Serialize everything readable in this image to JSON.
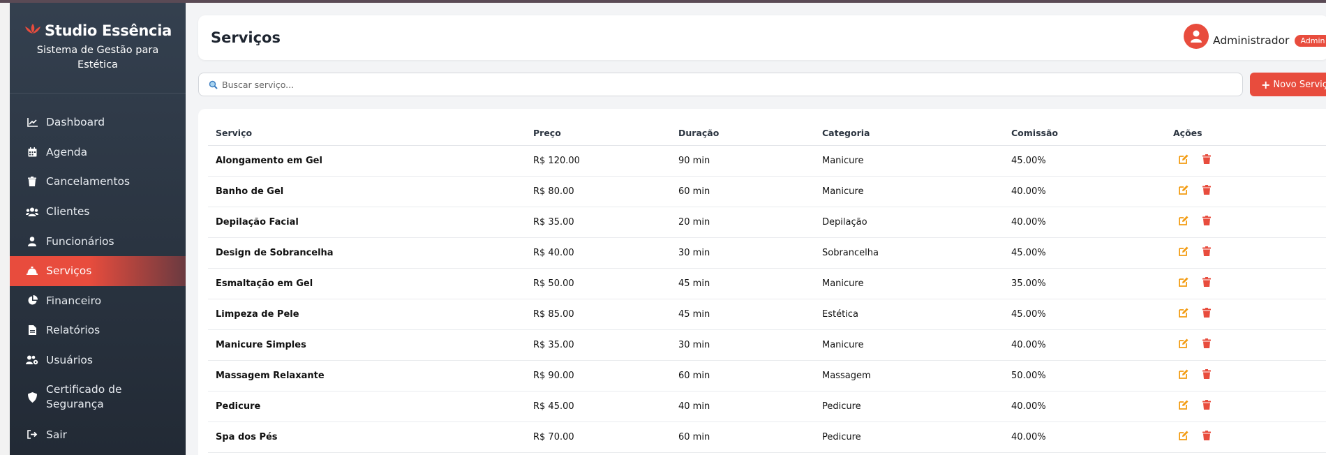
{
  "brand": {
    "title": "Studio Essência",
    "subtitle": "Sistema de Gestão para Estética",
    "accent": "#e84c3d"
  },
  "sidebar": {
    "items": [
      {
        "label": "Dashboard",
        "icon": "chart-line-icon"
      },
      {
        "label": "Agenda",
        "icon": "calendar-icon"
      },
      {
        "label": "Cancelamentos",
        "icon": "trash-icon"
      },
      {
        "label": "Clientes",
        "icon": "users-icon"
      },
      {
        "label": "Funcionários",
        "icon": "user-icon"
      },
      {
        "label": "Serviços",
        "icon": "concierge-bell-icon",
        "active": true
      },
      {
        "label": "Financeiro",
        "icon": "pie-chart-icon"
      },
      {
        "label": "Relatórios",
        "icon": "file-icon"
      },
      {
        "label": "Usuários",
        "icon": "users-cog-icon"
      },
      {
        "label": "Certificado de Segurança",
        "icon": "shield-icon"
      },
      {
        "label": "Sair",
        "icon": "sign-out-icon"
      }
    ]
  },
  "header": {
    "title": "Serviços",
    "user_name": "Administrador",
    "role_badge": "Admin"
  },
  "search": {
    "placeholder": "Buscar serviço..."
  },
  "toolbar": {
    "new_label": "Novo Serviço"
  },
  "table": {
    "columns": [
      "Serviço",
      "Preço",
      "Duração",
      "Categoria",
      "Comissão",
      "Ações"
    ],
    "rows": [
      [
        "Alongamento em Gel",
        "R$ 120.00",
        "90 min",
        "Manicure",
        "45.00%"
      ],
      [
        "Banho de Gel",
        "R$ 80.00",
        "60 min",
        "Manicure",
        "40.00%"
      ],
      [
        "Depilação Facial",
        "R$ 35.00",
        "20 min",
        "Depilação",
        "40.00%"
      ],
      [
        "Design de Sobrancelha",
        "R$ 40.00",
        "30 min",
        "Sobrancelha",
        "45.00%"
      ],
      [
        "Esmaltação em Gel",
        "R$ 50.00",
        "45 min",
        "Manicure",
        "35.00%"
      ],
      [
        "Limpeza de Pele",
        "R$ 85.00",
        "45 min",
        "Estética",
        "45.00%"
      ],
      [
        "Manicure Simples",
        "R$ 35.00",
        "30 min",
        "Manicure",
        "40.00%"
      ],
      [
        "Massagem Relaxante",
        "R$ 90.00",
        "60 min",
        "Massagem",
        "50.00%"
      ],
      [
        "Pedicure",
        "R$ 45.00",
        "40 min",
        "Pedicure",
        "40.00%"
      ],
      [
        "Spa dos Pés",
        "R$ 70.00",
        "60 min",
        "Pedicure",
        "40.00%"
      ]
    ]
  },
  "colors": {
    "edit_icon": "#f39c12",
    "delete_icon": "#e84c3d"
  }
}
